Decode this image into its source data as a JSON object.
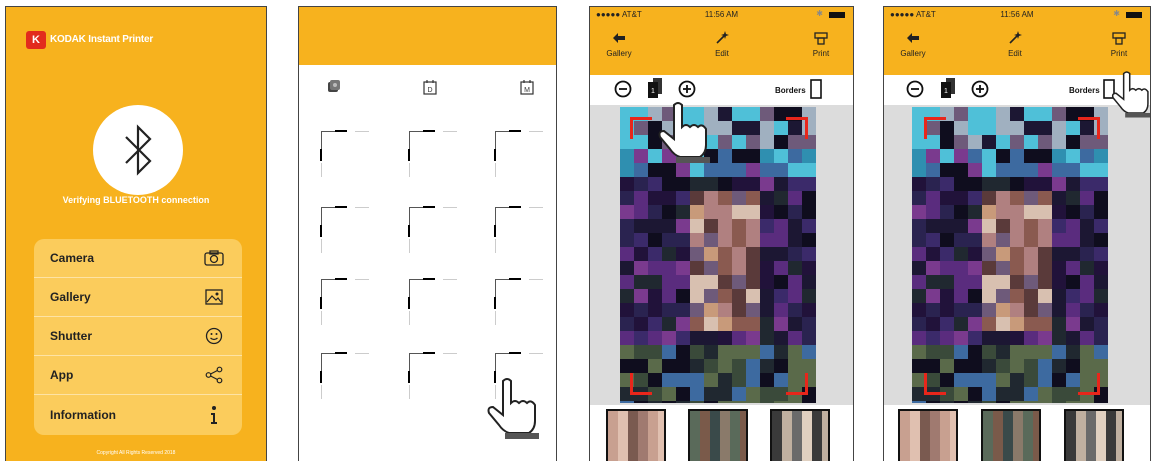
{
  "screen1": {
    "brand": "KODAK",
    "brand_suffix": "Instant Printer",
    "logo_letter": "K",
    "status_text": "Verifying BLUETOOTH connection",
    "menu": [
      {
        "label": "Camera",
        "icon": "camera-icon"
      },
      {
        "label": "Gallery",
        "icon": "image-icon"
      },
      {
        "label": "Shutter",
        "icon": "smiley-icon"
      },
      {
        "label": "App",
        "icon": "share-icon"
      },
      {
        "label": "Information",
        "icon": "info-icon"
      }
    ],
    "copyright": "Copyright All Rights Reserved 2018"
  },
  "screen2": {
    "filters": [
      {
        "icon": "photo-stack-icon",
        "label": ""
      },
      {
        "icon": "calendar-day-icon",
        "label": "D"
      },
      {
        "icon": "calendar-month-icon",
        "label": "M"
      }
    ]
  },
  "editor": {
    "carrier": "●●●●● AT&T",
    "time": "11:56 AM",
    "toolbar": {
      "gallery": "Gallery",
      "edit": "Edit",
      "print": "Print"
    },
    "borders_label": "Borders",
    "copies_count": "1"
  },
  "colors": {
    "kodak_yellow": "#f7b21e",
    "menu_panel": "#fbcc5c",
    "kodak_red": "#e22b1d",
    "crop_red": "#e8261b"
  }
}
